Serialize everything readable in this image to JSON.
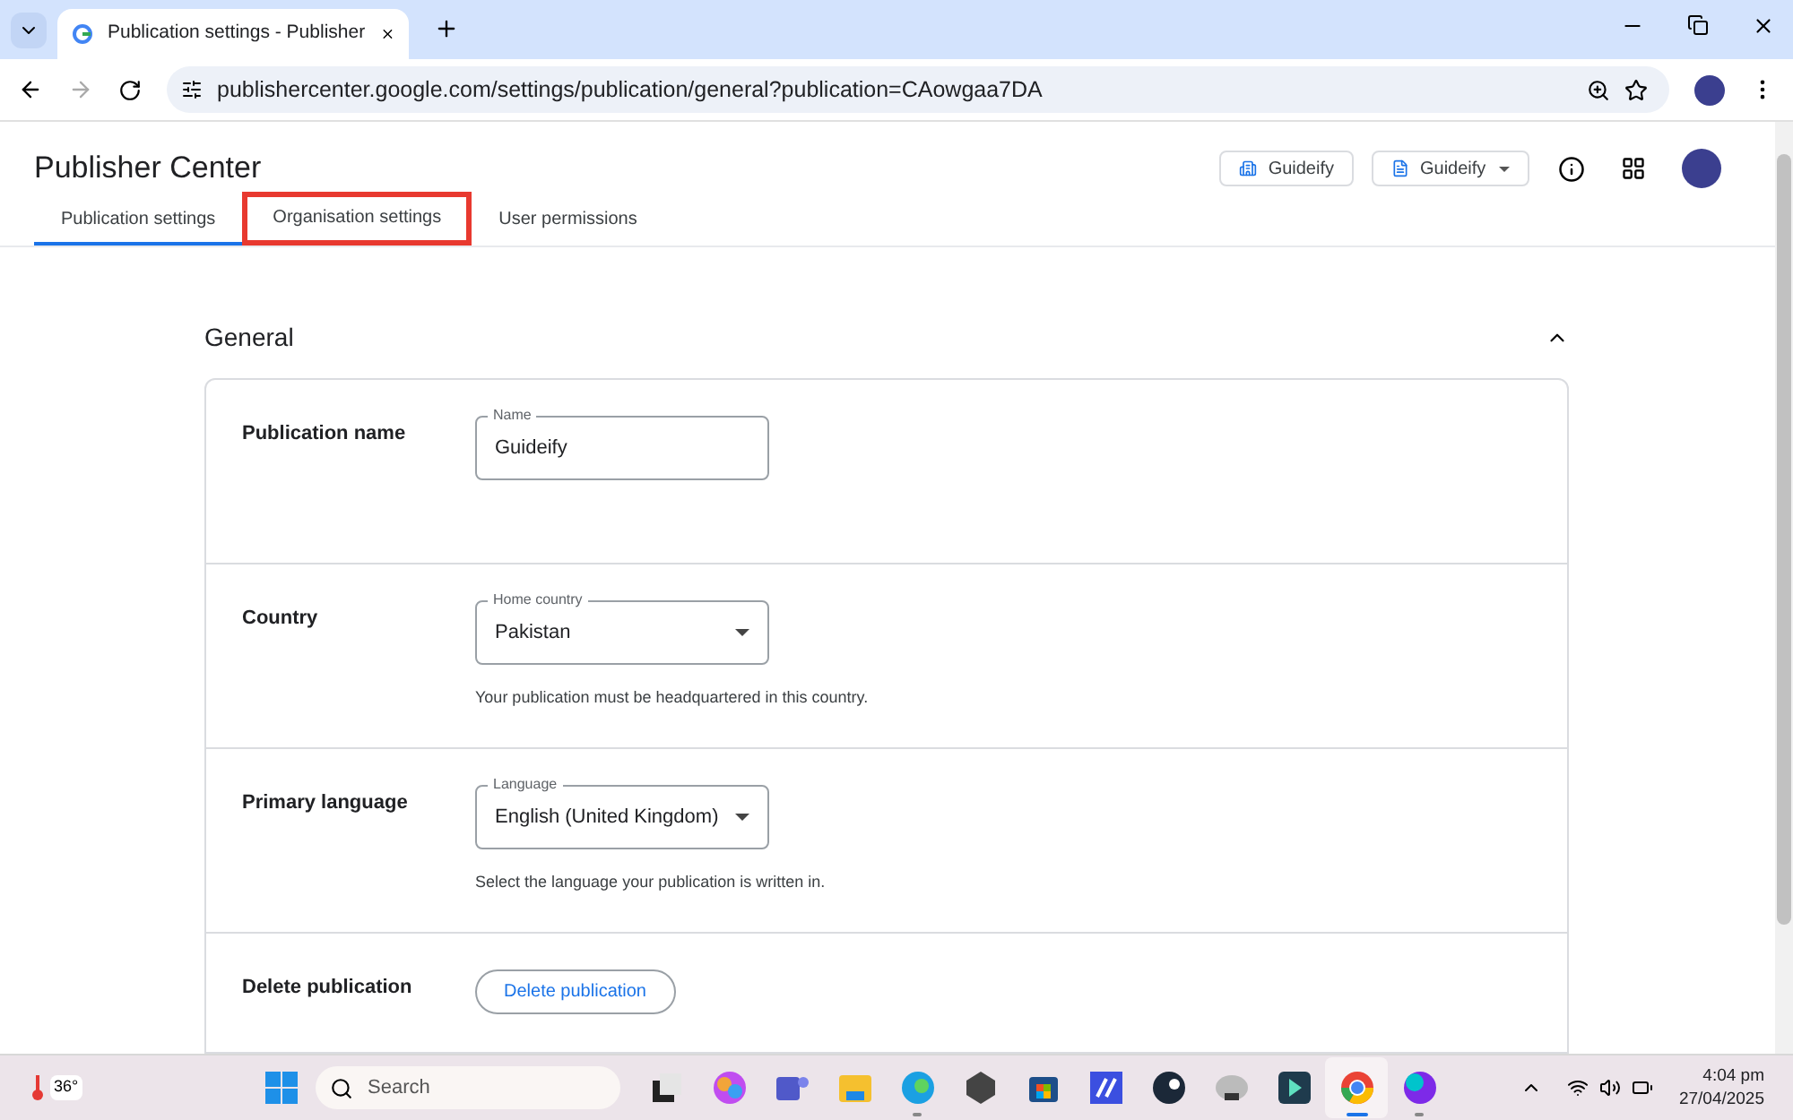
{
  "browser": {
    "tab_title": "Publication settings - Publisher",
    "url": "publishercenter.google.com/settings/publication/general?publication=CAowgaa7DA"
  },
  "header": {
    "title": "Publisher Center",
    "org_button": "Guideify",
    "publication_button": "Guideify"
  },
  "tabs": [
    {
      "label": "Publication settings",
      "selected": true,
      "highlighted": false
    },
    {
      "label": "Organisation settings",
      "selected": false,
      "highlighted": true
    },
    {
      "label": "User permissions",
      "selected": false,
      "highlighted": false
    }
  ],
  "section": {
    "title": "General",
    "expanded": true,
    "rows": [
      {
        "kind": "text",
        "label": "Publication name",
        "field_label": "Name",
        "value": "Guideify"
      },
      {
        "kind": "select",
        "label": "Country",
        "field_label": "Home country",
        "value": "Pakistan",
        "help": "Your publication must be headquartered in this country."
      },
      {
        "kind": "select",
        "label": "Primary language",
        "field_label": "Language",
        "value": "English (United Kingdom)",
        "help": "Select the language your publication is written in."
      },
      {
        "kind": "action",
        "label": "Delete publication",
        "button": "Delete publication"
      }
    ]
  },
  "taskbar": {
    "weather": "36°",
    "search_placeholder": "Search",
    "apps": [
      {
        "kind": "files",
        "running": false,
        "active": false
      },
      {
        "kind": "copilot",
        "running": false,
        "active": false
      },
      {
        "kind": "teams",
        "running": false,
        "active": false
      },
      {
        "kind": "explorer",
        "running": false,
        "active": false
      },
      {
        "kind": "edge",
        "running": true,
        "active": false
      },
      {
        "kind": "hex",
        "running": false,
        "active": false
      },
      {
        "kind": "store",
        "running": false,
        "active": false
      },
      {
        "kind": "editor",
        "running": false,
        "active": false
      },
      {
        "kind": "steam",
        "running": false,
        "active": false
      },
      {
        "kind": "disk",
        "running": false,
        "active": false
      },
      {
        "kind": "filmora",
        "running": false,
        "active": false
      },
      {
        "kind": "chrome",
        "running": true,
        "active": true
      },
      {
        "kind": "canva",
        "running": true,
        "active": false
      }
    ],
    "time": "4:04 pm",
    "date": "27/04/2025"
  }
}
